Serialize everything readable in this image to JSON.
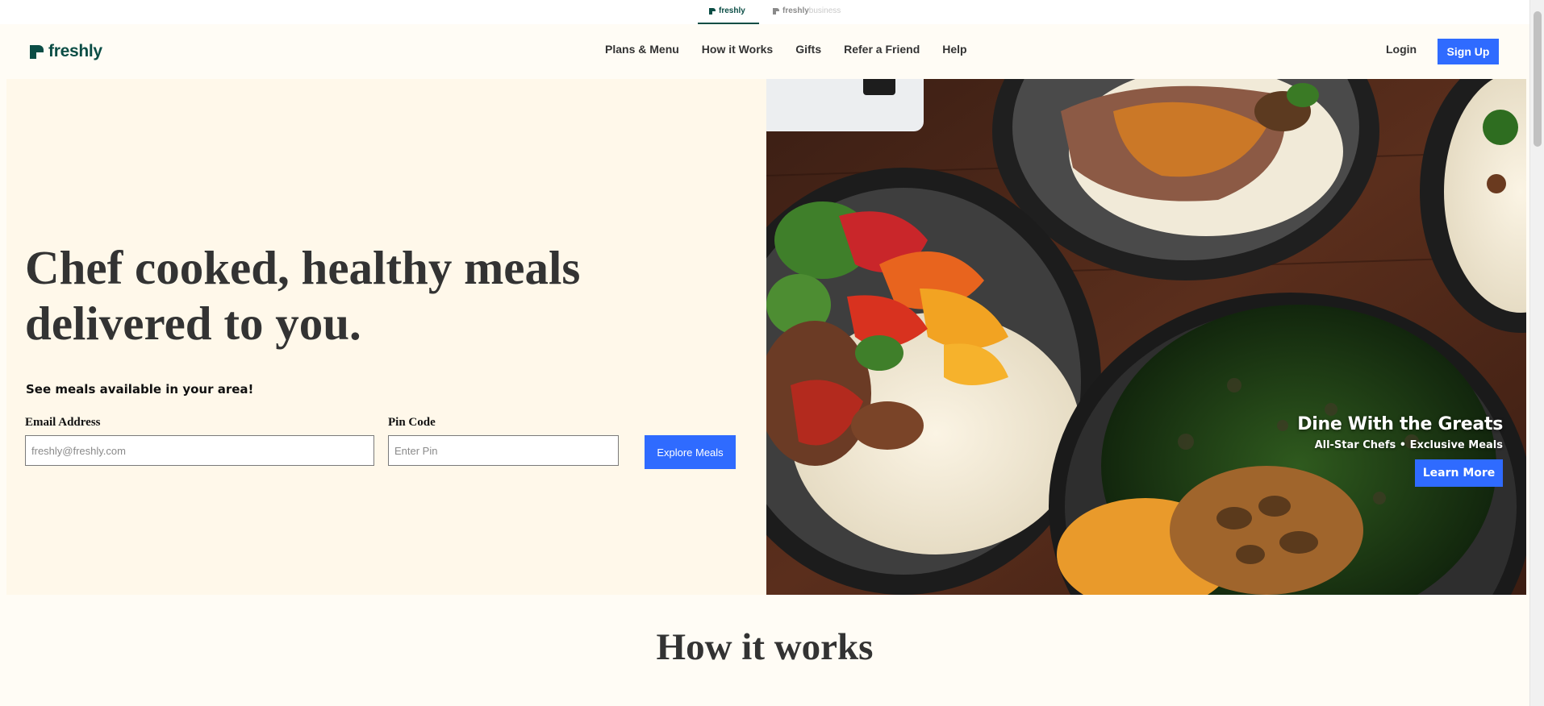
{
  "brand_switcher": {
    "active": "freshly",
    "inactive_name": "freshly",
    "inactive_suffix": "business"
  },
  "header": {
    "logo_text": "freshly",
    "nav": [
      "Plans & Menu",
      "How it Works",
      "Gifts",
      "Refer a Friend",
      "Help"
    ],
    "login_label": "Login",
    "signup_label": "Sign Up"
  },
  "hero": {
    "title": "Chef cooked, healthy meals delivered to you.",
    "subtitle": "See meals available in your area!",
    "email": {
      "label": "Email Address",
      "placeholder": "freshly@freshly.com",
      "value": ""
    },
    "pin": {
      "label": "Pin Code",
      "placeholder": "Enter Pin",
      "value": ""
    },
    "explore_label": "Explore Meals"
  },
  "promo": {
    "title": "Dine With the Greats",
    "subtitle": "All-Star Chefs • Exclusive Meals",
    "button_label": "Learn More"
  },
  "section": {
    "how_title": "How it works"
  },
  "colors": {
    "brand_green": "#0b4d45",
    "accent_blue": "#2f6bff",
    "hero_bg": "#fff8ea",
    "page_bg": "#fffcf5"
  }
}
